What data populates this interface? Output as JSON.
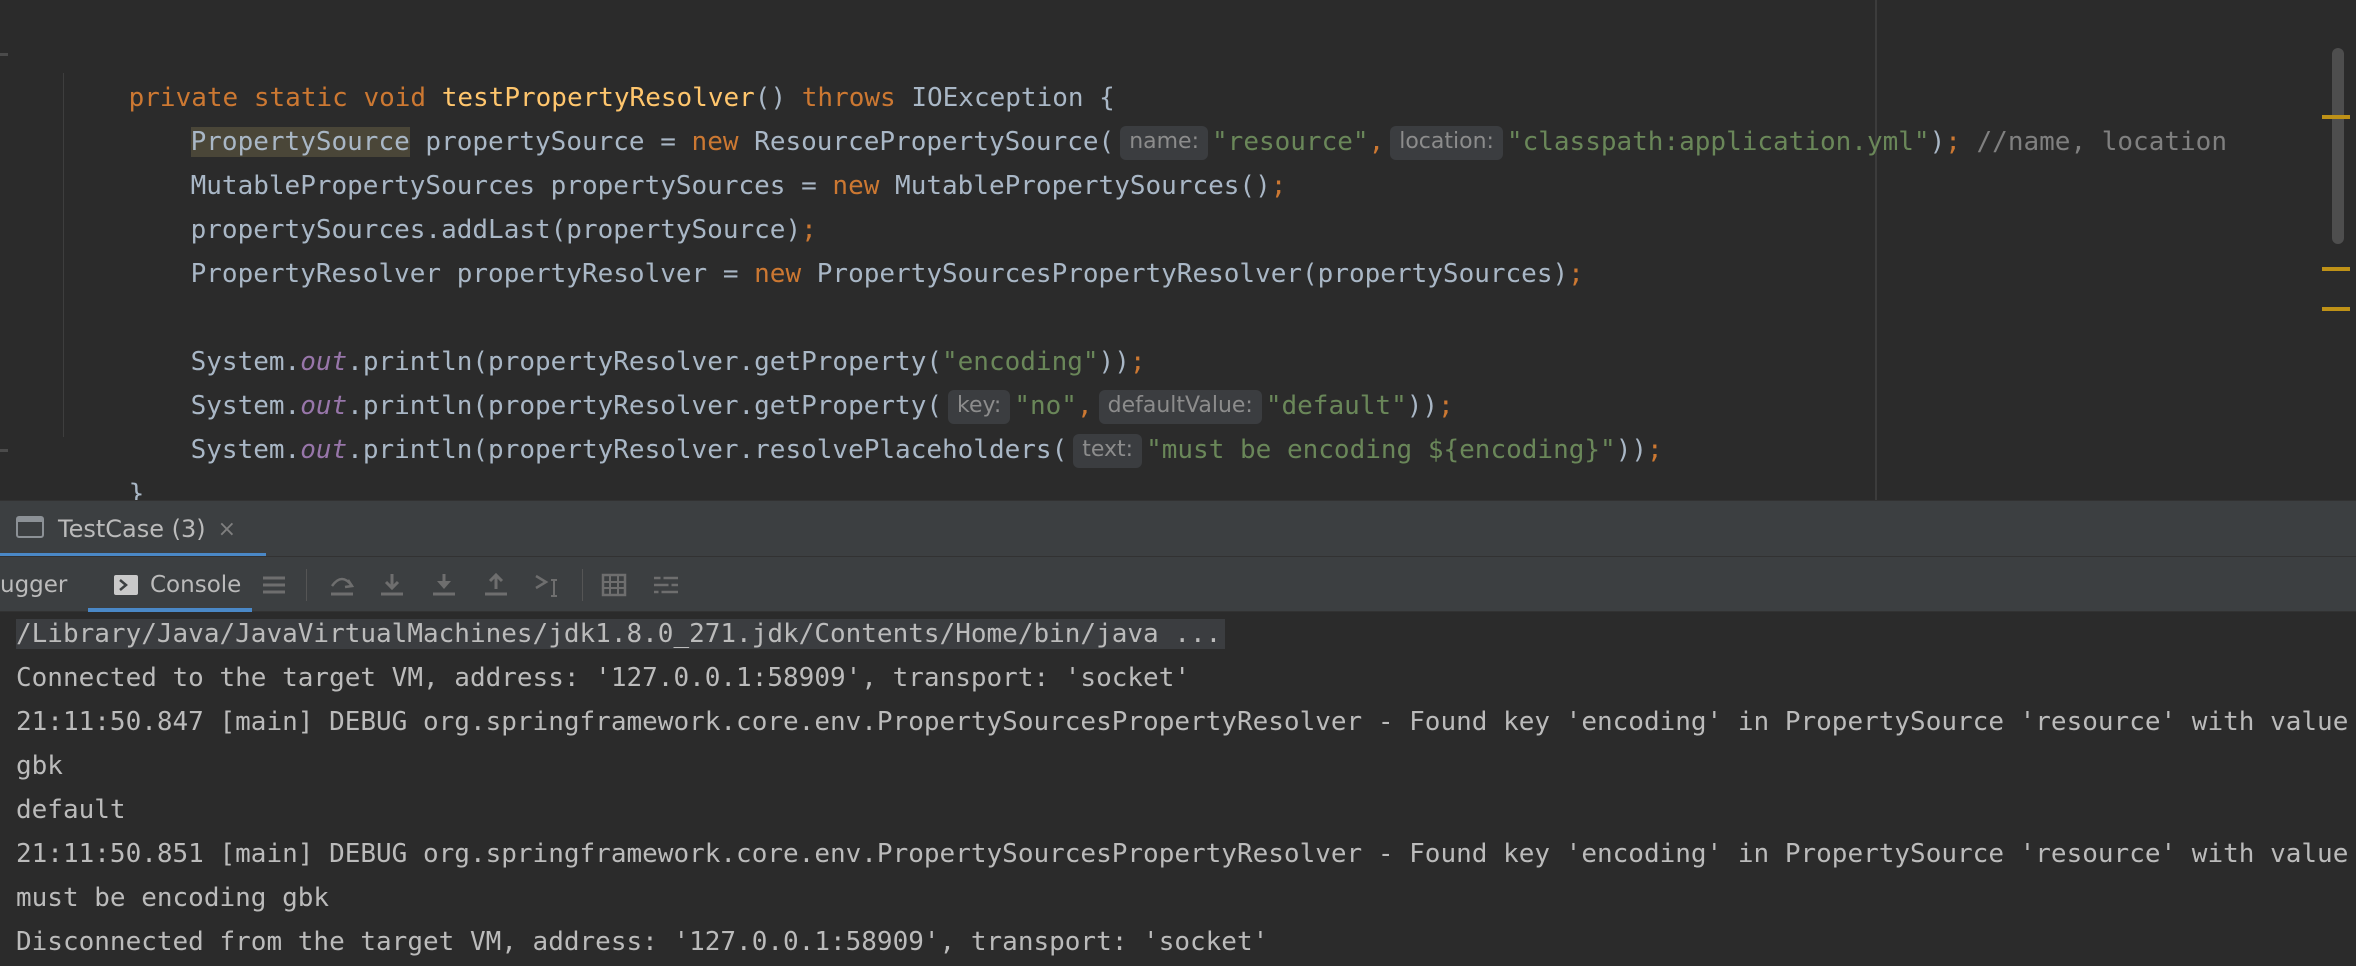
{
  "editor": {
    "line1": {
      "kw1": "private",
      "kw2": "static",
      "kw3": "void",
      "method": "testPropertyResolver",
      "sig": "()",
      "throws": "throws",
      "exc": "IOException {"
    },
    "line2": {
      "type": "PropertySource",
      "decl": " propertySource = ",
      "new": "new",
      "ctor": " ResourcePropertySource(",
      "hint1": "name:",
      "str1": "\"resource\"",
      "comma": ",",
      "hint2": "location:",
      "str2": "\"classpath:application.yml\"",
      "close": ")",
      "semi": ";",
      "comment": " //name, location"
    },
    "line3": {
      "decl": "MutablePropertySources propertySources = ",
      "new": "new",
      "ctor": " MutablePropertySources()",
      "semi": ";"
    },
    "line4": {
      "code": "propertySources.addLast(propertySource)",
      "semi": ";"
    },
    "line5": {
      "decl": "PropertyResolver propertyResolver = ",
      "new": "new",
      "ctor": " PropertySourcesPropertyResolver(propertySources)",
      "semi": ";"
    },
    "line6": {
      "sys": "System.",
      "out": "out",
      "call": ".println(propertyResolver.getProperty(",
      "str": "\"encoding\"",
      "close": "))",
      "semi": ";"
    },
    "line7": {
      "sys": "System.",
      "out": "out",
      "call": ".println(propertyResolver.getProperty(",
      "hint1": "key:",
      "str1": "\"no\"",
      "comma": ",",
      "hint2": "defaultValue:",
      "str2": "\"default\"",
      "close": "))",
      "semi": ";"
    },
    "line8": {
      "sys": "System.",
      "out": "out",
      "call": ".println(propertyResolver.resolvePlaceholders(",
      "hint": "text:",
      "str": "\"must be encoding ${encoding}\"",
      "close": "))",
      "semi": ";"
    },
    "line9": "}"
  },
  "tool_window": {
    "tab_label": "TestCase (3)",
    "tab_close": "×",
    "debugger_label": "ugger",
    "console_label": "Console",
    "icons": [
      "console-icon",
      "list-icon",
      "step-over-icon",
      "step-into-icon",
      "force-step-into-icon",
      "step-out-icon",
      "run-to-cursor-icon",
      "evaluate-table-icon",
      "trace-icon"
    ]
  },
  "console": {
    "lines": [
      "/Library/Java/JavaVirtualMachines/jdk1.8.0_271.jdk/Contents/Home/bin/java ...",
      "Connected to the target VM, address: '127.0.0.1:58909', transport: 'socket'",
      "21:11:50.847 [main] DEBUG org.springframework.core.env.PropertySourcesPropertyResolver - Found key 'encoding' in PropertySource 'resource' with value",
      "gbk",
      "default",
      "21:11:50.851 [main] DEBUG org.springframework.core.env.PropertySourcesPropertyResolver - Found key 'encoding' in PropertySource 'resource' with value",
      "must be encoding gbk",
      "Disconnected from the target VM, address: '127.0.0.1:58909', transport: 'socket'"
    ]
  },
  "colors": {
    "keyword": "#cc7832",
    "method": "#ffc66d",
    "string": "#6a8759",
    "comment": "#808080",
    "field": "#9876aa",
    "accent": "#4a88c7",
    "stripe": "#be9117"
  }
}
